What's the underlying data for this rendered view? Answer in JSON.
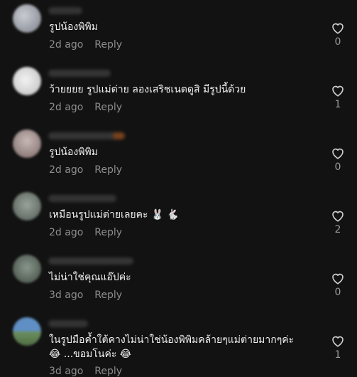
{
  "comments": [
    {
      "text": "รูปน้องพิพิม",
      "time": "2d ago",
      "reply": "Reply",
      "likes": "0"
    },
    {
      "text": "ว้ายยยย รูปแม่ต่าย ลองเสริชเนตดูสิ มีรูปนี้ด้วย",
      "time": "2d ago",
      "reply": "Reply",
      "likes": "1"
    },
    {
      "text": "รูปน้องพิพิม",
      "time": "2d ago",
      "reply": "Reply",
      "likes": "0"
    },
    {
      "text": "เหมือนรูปแม่ต่ายเลยคะ 🐰 🐇",
      "time": "2d ago",
      "reply": "Reply",
      "likes": "2"
    },
    {
      "text": "ไม่น่าใช่คุณแอ๊ปค่ะ",
      "time": "3d ago",
      "reply": "Reply",
      "likes": "0"
    },
    {
      "text": "ในรูปมือค้ำใต้คางไม่น่าใช่น้องพิพิมคล้ายๆแม่ต่ายมากๆค่ะ",
      "text2": "😂 ...ขอมโนค่ะ 😂",
      "time": "3d ago",
      "reply": "Reply",
      "likes": "1"
    }
  ],
  "colors": {
    "background": "#121212",
    "text": "#f1f1f1",
    "muted": "#8e8e8e"
  },
  "icons": {
    "like": "heart-outline-icon"
  }
}
